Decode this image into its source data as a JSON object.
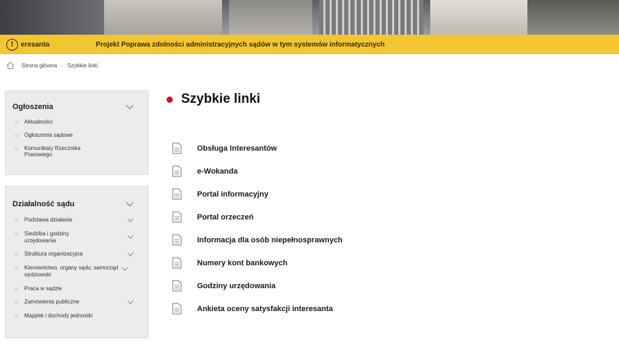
{
  "alert": {
    "label": "eresanta",
    "text": "Projekt Poprawa zdolności administracyjnych sądów w tym systemów informatycznych",
    "color": "#f2c531"
  },
  "breadcrumb": {
    "home": "Strona główna",
    "current": "Szybkie linki"
  },
  "sidebar": {
    "ogloszenia": {
      "title": "Ogłoszenia",
      "items": [
        {
          "label": "Aktualności"
        },
        {
          "label": "Ogłoszenia sądowe"
        },
        {
          "label": "Komunikaty Rzecznika Prasowego"
        }
      ]
    },
    "dzialalnosc": {
      "title": "Działalność sądu",
      "items": [
        {
          "label": "Podstawa działania"
        },
        {
          "label": "Siedziba i godziny urzędowania"
        },
        {
          "label": "Struktura organizacyjna"
        },
        {
          "label": "Kierownictwo, organy sądu, samorząd sędziowski"
        },
        {
          "label": "Praca w sądzie"
        },
        {
          "label": "Zamówienia publiczne"
        },
        {
          "label": "Majątek i dochody jednostki"
        }
      ]
    }
  },
  "main": {
    "title": "Szybkie linki",
    "accent_color": "#c9161d",
    "links": [
      {
        "label": "Obsługa Interesantów"
      },
      {
        "label": "e-Wokanda"
      },
      {
        "label": "Portal informacyjny"
      },
      {
        "label": "Portal orzeczeń"
      },
      {
        "label": "Informacja dla osób niepełnosprawnych"
      },
      {
        "label": "Numery kont bankowych"
      },
      {
        "label": "Godziny urzędowania"
      },
      {
        "label": "Ankieta oceny satysfakcji interesanta"
      }
    ]
  }
}
